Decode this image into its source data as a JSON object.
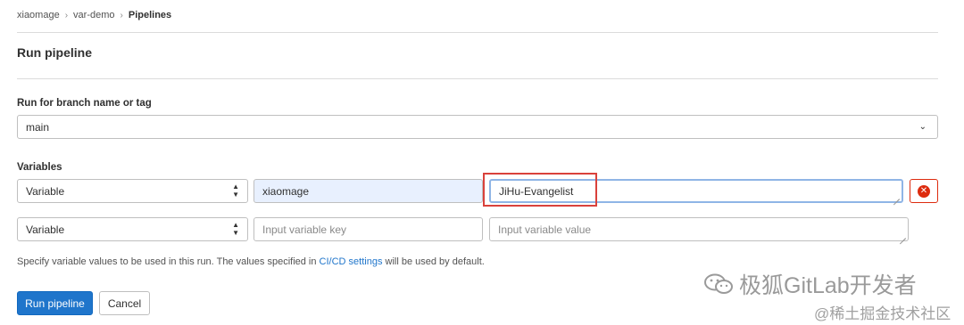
{
  "breadcrumb": {
    "items": [
      "xiaomage",
      "var-demo"
    ],
    "current": "Pipelines"
  },
  "page": {
    "title": "Run pipeline"
  },
  "branch": {
    "label": "Run for branch name or tag",
    "value": "main"
  },
  "variables": {
    "label": "Variables",
    "rows": [
      {
        "type": "Variable",
        "key": "xiaomage",
        "key_placeholder": "Input variable key",
        "value": "JiHu-Evangelist",
        "value_placeholder": "Input variable value"
      },
      {
        "type": "Variable",
        "key": "",
        "key_placeholder": "Input variable key",
        "value": "",
        "value_placeholder": "Input variable value"
      }
    ]
  },
  "help": {
    "prefix": "Specify variable values to be used in this run. The values specified in ",
    "link": "CI/CD settings",
    "suffix": " will be used by default."
  },
  "buttons": {
    "run": "Run pipeline",
    "cancel": "Cancel"
  },
  "watermark": {
    "line1": "极狐GitLab开发者",
    "line2": "@稀土掘金技术社区"
  },
  "colors": {
    "primary": "#1f75cb",
    "danger": "#dd2b0e",
    "highlight": "#d9413b"
  }
}
